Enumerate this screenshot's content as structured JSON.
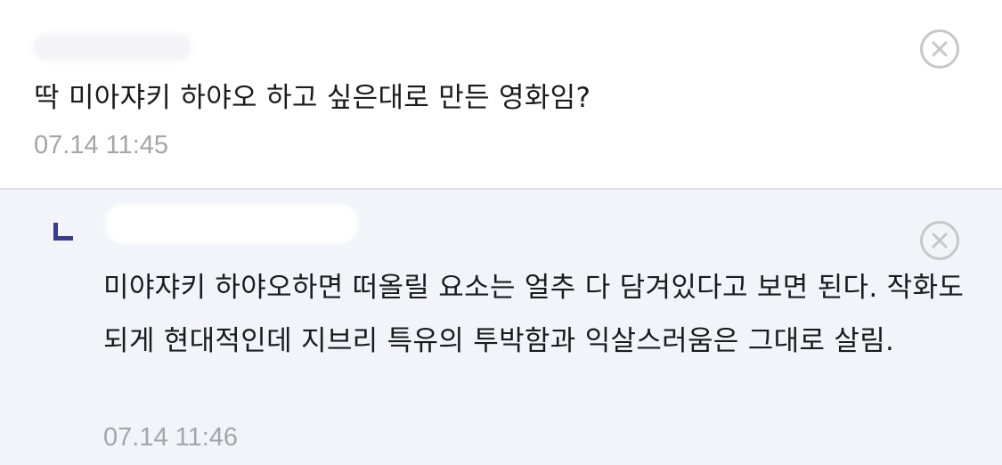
{
  "comments": [
    {
      "text": "딱 미아쟈키 하야오 하고 싶은대로 만든 영화임?",
      "time": "07.14 11:45"
    },
    {
      "text": "미야쟈키 하야오하면 떠올릴 요소는 얼추 다 담겨있다고 보면 된다. 작화도 되게 현대적인데 지브리 특유의 투박함과 익살스러움은 그대로 살림.",
      "time": "07.14 11:46",
      "is_reply": true
    }
  ],
  "icons": {
    "delete": "close-circle-icon",
    "reply": "reply-indicator-icon"
  },
  "colors": {
    "reply_mark": "#3c3a8a",
    "reply_bg": "#f3f4fa",
    "timestamp": "#a5a5a5"
  }
}
